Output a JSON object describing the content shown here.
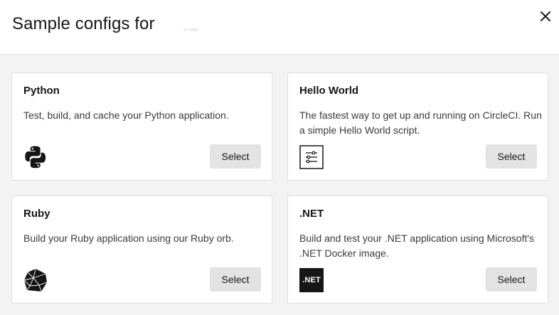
{
  "header": {
    "title": "Sample configs for",
    "close_icon": "close-icon"
  },
  "cards": [
    {
      "title": "Python",
      "description": "Test, build, and cache your Python application.",
      "icon": "python-icon",
      "select_label": "Select"
    },
    {
      "title": "Hello World",
      "description": "The fastest way to get up and running on CircleCI. Run a simple Hello World script.",
      "icon": "hello-world-sliders-icon",
      "select_label": "Select"
    },
    {
      "title": "Ruby",
      "description": "Build your Ruby application using our Ruby orb.",
      "icon": "ruby-icon",
      "select_label": "Select"
    },
    {
      "title": ".NET",
      "description": "Build and test your .NET application using Microsoft's .NET Docker image.",
      "icon": "dotnet-icon",
      "icon_text": ".NET",
      "select_label": "Select"
    }
  ],
  "colors": {
    "background": "#f3f3f3",
    "card": "#ffffff",
    "button": "#e3e3e3",
    "text": "#161616"
  }
}
